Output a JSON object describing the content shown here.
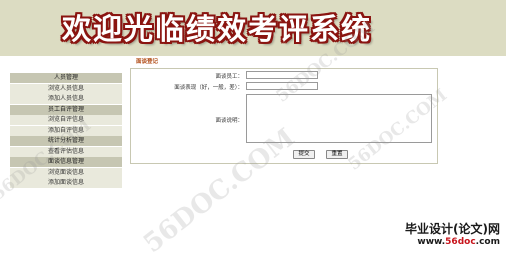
{
  "banner": {
    "title": "欢迎光临绩效考评系统"
  },
  "sidebar": {
    "items": [
      {
        "label": "人员管理",
        "kind": "category"
      },
      {
        "label": "浏览人员信息",
        "kind": "item"
      },
      {
        "label": "添加人员信息",
        "kind": "item"
      },
      {
        "label": "员工自评管理",
        "kind": "category"
      },
      {
        "label": "浏览自评信息",
        "kind": "item"
      },
      {
        "label": "添加自评信息",
        "kind": "item"
      },
      {
        "label": "统计分析管理",
        "kind": "category"
      },
      {
        "label": "查看评估信息",
        "kind": "item"
      },
      {
        "label": "面谈信息管理",
        "kind": "category"
      },
      {
        "label": "浏览面谈信息",
        "kind": "item"
      },
      {
        "label": "添加面谈信息",
        "kind": "item"
      }
    ]
  },
  "main": {
    "section_title": "面谈登记",
    "form": {
      "employee_label": "面谈员工：",
      "employee_value": "",
      "performance_label": "面谈表现（好，一般，差）：",
      "performance_value": "",
      "notes_label": "面谈说明：",
      "notes_value": "",
      "submit_label": "提交",
      "reset_label": "重置"
    }
  },
  "watermarks": {
    "text": "56DOC.COM"
  },
  "footer": {
    "title": "毕业设计(论文)网",
    "url_prefix": "www.",
    "url_highlight": "56doc",
    "url_suffix": ".com"
  },
  "colors": {
    "banner_bg": "#dcdcc2",
    "title_outline": "#8a1410",
    "category_bg": "#c6c6b2",
    "item_bg": "#e9e9dc",
    "section_title": "#b04a14"
  }
}
